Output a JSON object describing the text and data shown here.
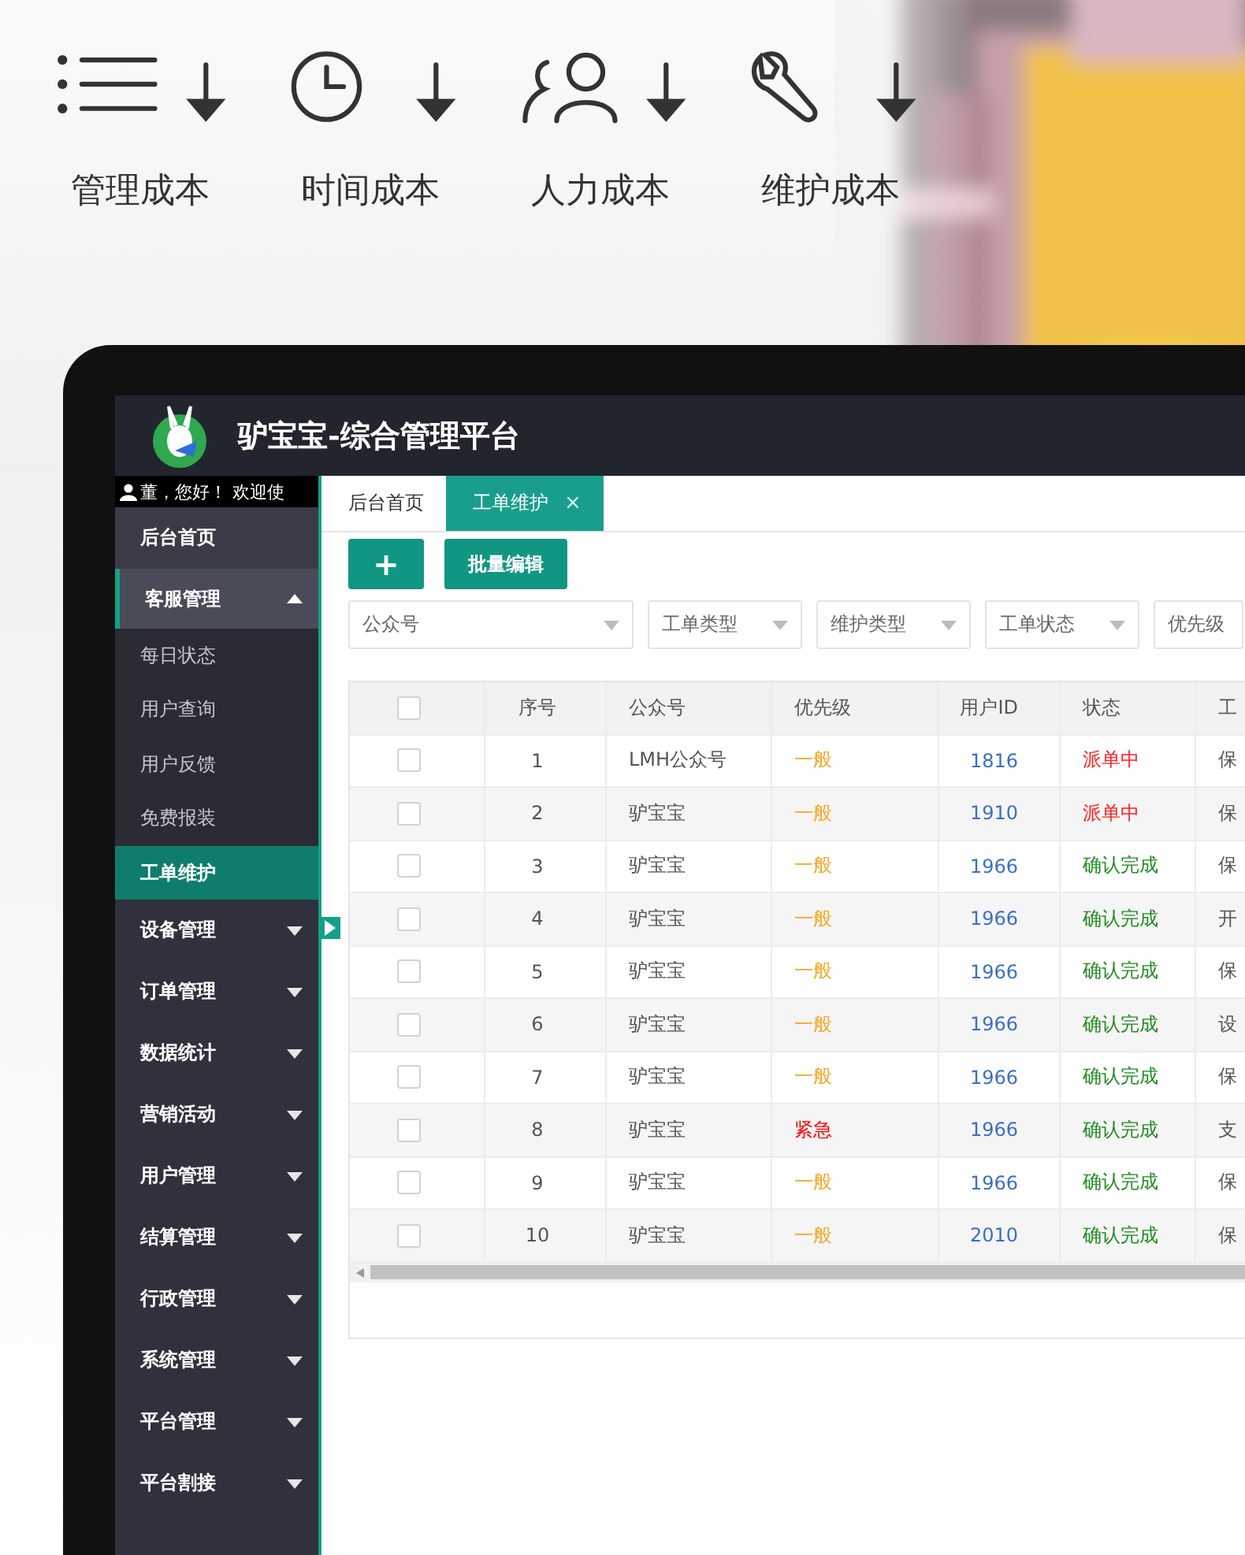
{
  "features": [
    {
      "kind": "list",
      "label": "管理成本"
    },
    {
      "kind": "clock",
      "label": "时间成本"
    },
    {
      "kind": "people",
      "label": "人力成本"
    },
    {
      "kind": "wrench",
      "label": "维护成本"
    }
  ],
  "app": {
    "title": "驴宝宝-综合管理平台",
    "greeting": "董，您好！ 欢迎使"
  },
  "sidebar": {
    "items": [
      {
        "label": "后台首页",
        "kind": "link",
        "selected": false
      },
      {
        "label": "客服管理",
        "kind": "group",
        "expanded": true,
        "children": [
          {
            "label": "每日状态",
            "selected": false
          },
          {
            "label": "用户查询",
            "selected": false
          },
          {
            "label": "用户反馈",
            "selected": false
          },
          {
            "label": "免费报装",
            "selected": false
          },
          {
            "label": "工单维护",
            "selected": true
          }
        ]
      },
      {
        "label": "设备管理",
        "kind": "group",
        "expanded": false
      },
      {
        "label": "订单管理",
        "kind": "group",
        "expanded": false
      },
      {
        "label": "数据统计",
        "kind": "group",
        "expanded": false
      },
      {
        "label": "营销活动",
        "kind": "group",
        "expanded": false
      },
      {
        "label": "用户管理",
        "kind": "group",
        "expanded": false
      },
      {
        "label": "结算管理",
        "kind": "group",
        "expanded": false
      },
      {
        "label": "行政管理",
        "kind": "group",
        "expanded": false
      },
      {
        "label": "系统管理",
        "kind": "group",
        "expanded": false
      },
      {
        "label": "平台管理",
        "kind": "group",
        "expanded": false
      },
      {
        "label": "平台割接",
        "kind": "group",
        "expanded": false
      }
    ]
  },
  "tabs": [
    {
      "label": "后台首页",
      "selected": false
    },
    {
      "label": "工单维护",
      "selected": true,
      "close": "×"
    }
  ],
  "toolbar": {
    "add": "+",
    "batch_edit": "批量编辑"
  },
  "filters": [
    {
      "placeholder": "公众号"
    },
    {
      "placeholder": "工单类型"
    },
    {
      "placeholder": "维护类型"
    },
    {
      "placeholder": "工单状态"
    },
    {
      "placeholder": "优先级"
    }
  ],
  "table": {
    "header_checked": false,
    "columns": [
      "序号",
      "公众号",
      "优先级",
      "用户ID",
      "状态",
      "工"
    ],
    "rows": [
      {
        "checked": false,
        "no": "1",
        "account": "LMH公众号",
        "priority": {
          "text": "一般",
          "color": "#f5a623"
        },
        "user_id": "1816",
        "status": {
          "text": "派单中",
          "color": "#ff2020"
        },
        "column_7": "保"
      },
      {
        "checked": false,
        "no": "2",
        "account": "驴宝宝",
        "priority": {
          "text": "一般",
          "color": "#f5a623"
        },
        "user_id": "1910",
        "status": {
          "text": "派单中",
          "color": "#ff2020"
        },
        "column_7": "保"
      },
      {
        "checked": false,
        "no": "3",
        "account": "驴宝宝",
        "priority": {
          "text": "一般",
          "color": "#f5a623"
        },
        "user_id": "1966",
        "status": {
          "text": "确认完成",
          "color": "#1f8a1f"
        },
        "column_7": "保"
      },
      {
        "checked": false,
        "no": "4",
        "account": "驴宝宝",
        "priority": {
          "text": "一般",
          "color": "#f5a623"
        },
        "user_id": "1966",
        "status": {
          "text": "确认完成",
          "color": "#1f8a1f"
        },
        "column_7": "开"
      },
      {
        "checked": false,
        "no": "5",
        "account": "驴宝宝",
        "priority": {
          "text": "一般",
          "color": "#f5a623"
        },
        "user_id": "1966",
        "status": {
          "text": "确认完成",
          "color": "#1f8a1f"
        },
        "column_7": "保"
      },
      {
        "checked": false,
        "no": "6",
        "account": "驴宝宝",
        "priority": {
          "text": "一般",
          "color": "#f5a623"
        },
        "user_id": "1966",
        "status": {
          "text": "确认完成",
          "color": "#1f8a1f"
        },
        "column_7": "设"
      },
      {
        "checked": false,
        "no": "7",
        "account": "驴宝宝",
        "priority": {
          "text": "一般",
          "color": "#f5a623"
        },
        "user_id": "1966",
        "status": {
          "text": "确认完成",
          "color": "#1f8a1f"
        },
        "column_7": "保"
      },
      {
        "checked": false,
        "no": "8",
        "account": "驴宝宝",
        "priority": {
          "text": "紧急",
          "color": "#ff0000"
        },
        "user_id": "1966",
        "status": {
          "text": "确认完成",
          "color": "#1f8a1f"
        },
        "column_7": "支"
      },
      {
        "checked": false,
        "no": "9",
        "account": "驴宝宝",
        "priority": {
          "text": "一般",
          "color": "#f5a623"
        },
        "user_id": "1966",
        "status": {
          "text": "确认完成",
          "color": "#1f8a1f"
        },
        "column_7": "保"
      },
      {
        "checked": false,
        "no": "10",
        "account": "驴宝宝",
        "priority": {
          "text": "一般",
          "color": "#f5a623"
        },
        "user_id": "2010",
        "status": {
          "text": "确认完成",
          "color": "#1f8a1f"
        },
        "column_7": "保"
      }
    ]
  }
}
